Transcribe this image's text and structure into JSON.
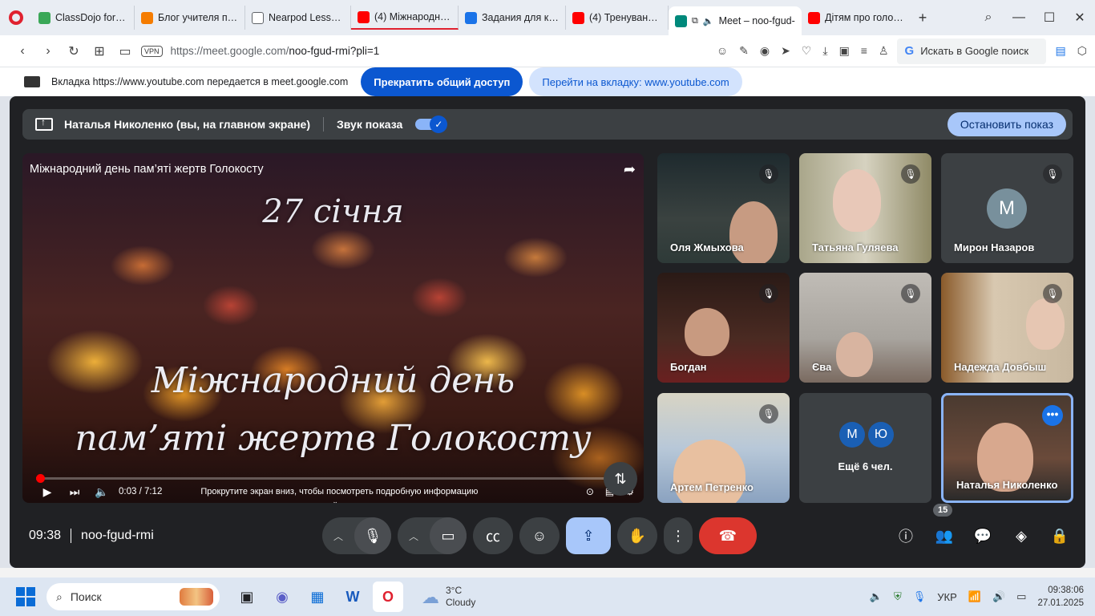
{
  "browser": {
    "tabs": [
      {
        "title": "ClassDojo for Teach",
        "color": "#3aa757"
      },
      {
        "title": "Блог учителя почат",
        "color": "#f57c00"
      },
      {
        "title": "Nearpod Lessons: D",
        "color": "#5f6368"
      },
      {
        "title": "(4) Міжнародний д",
        "color": "#ff0000"
      },
      {
        "title": "Задания для курса",
        "color": "#1a73e8"
      },
      {
        "title": "(4) Тренування на",
        "color": "#ff0000"
      },
      {
        "title": "Meet – noo-fgud-",
        "color": "#00897b"
      },
      {
        "title": "Дітям про голокос",
        "color": "#ff0000"
      }
    ],
    "url_prefix": "https://meet.google.com/",
    "url_path": "noo-fgud-rmi?pli=1",
    "vpn_label": "VPN",
    "search_label": "Искать в Google поиск",
    "search_g": "G"
  },
  "share_bar": {
    "text": "Вкладка https://www.youtube.com передается в meet.google.com",
    "stop_label": "Прекратить общий доступ",
    "goto_label": "Перейти на вкладку: www.youtube.com"
  },
  "presenting": {
    "name": "Наталья Николенко (вы, на главном экране)",
    "audio_label": "Звук показа",
    "stop_label": "Остановить показ"
  },
  "video": {
    "title": "Міжнародний день пам’яті жертв Голокосту",
    "slide_date": "27 січня",
    "slide_line1": "Міжнародний день",
    "slide_line2": "пам’яті жертв Голокосту",
    "time": "0:03 / 7:12",
    "progress": 0.007,
    "hint": "Прокрутите экран вниз, чтобы посмотреть подробную информацию"
  },
  "participants": [
    {
      "name": "Оля Жмыхова"
    },
    {
      "name": "Татьяна Гуляева"
    },
    {
      "name": "Мирон Назаров",
      "initial": "М"
    },
    {
      "name": "Богдан"
    },
    {
      "name": "Єва"
    },
    {
      "name": "Надежда Довбыш"
    },
    {
      "name": "Артем Петренко"
    },
    {
      "others_label": "Ещё 6 чел.",
      "initials": [
        "М",
        "Ю"
      ]
    },
    {
      "name": "Наталья Николенко"
    }
  ],
  "meeting": {
    "time": "09:38",
    "code": "noo-fgud-rmi",
    "participant_count": "15"
  },
  "taskbar": {
    "search_placeholder": "Поиск",
    "weather_temp": "3°C",
    "weather_desc": "Cloudy",
    "lang": "УКР",
    "time": "09:38:06",
    "date": "27.01.2025"
  }
}
